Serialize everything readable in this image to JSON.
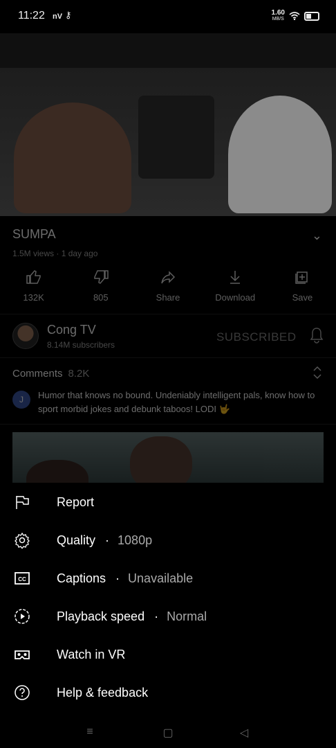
{
  "status_bar": {
    "time": "11:22",
    "carrier": "nV",
    "network_speed_value": "1.60",
    "network_speed_unit": "MB/S"
  },
  "video": {
    "title": "SUMPA",
    "views": "1.5M views",
    "age": "1 day ago"
  },
  "actions": {
    "like_count": "132K",
    "dislike_count": "805",
    "share_label": "Share",
    "download_label": "Download",
    "save_label": "Save"
  },
  "channel": {
    "name": "Cong TV",
    "subscribers": "8.14M subscribers",
    "subscribed_label": "SUBSCRIBED"
  },
  "comments": {
    "header": "Comments",
    "count": "8.2K",
    "avatar_letter": "J",
    "top_comment": "Humor that knows no bound. Undeniably intelligent pals, know how to sport morbid jokes and debunk taboos! LODI 🤟"
  },
  "menu": {
    "report": "Report",
    "quality_label": "Quality",
    "quality_value": "1080p",
    "captions_label": "Captions",
    "captions_value": "Unavailable",
    "playback_label": "Playback speed",
    "playback_value": "Normal",
    "vr_label": "Watch in VR",
    "help_label": "Help & feedback"
  },
  "colors": {
    "background": "#000000",
    "text_primary": "#ffffff",
    "text_secondary": "#aaaaaa",
    "comment_avatar": "#3d5aa8"
  },
  "icons": [
    "key-icon",
    "wifi-icon",
    "battery-icon",
    "like-icon",
    "dislike-icon",
    "share-icon",
    "download-icon",
    "save-icon",
    "bell-icon",
    "flag-icon",
    "gear-icon",
    "cc-icon",
    "playback-speed-icon",
    "vr-icon",
    "help-icon"
  ]
}
